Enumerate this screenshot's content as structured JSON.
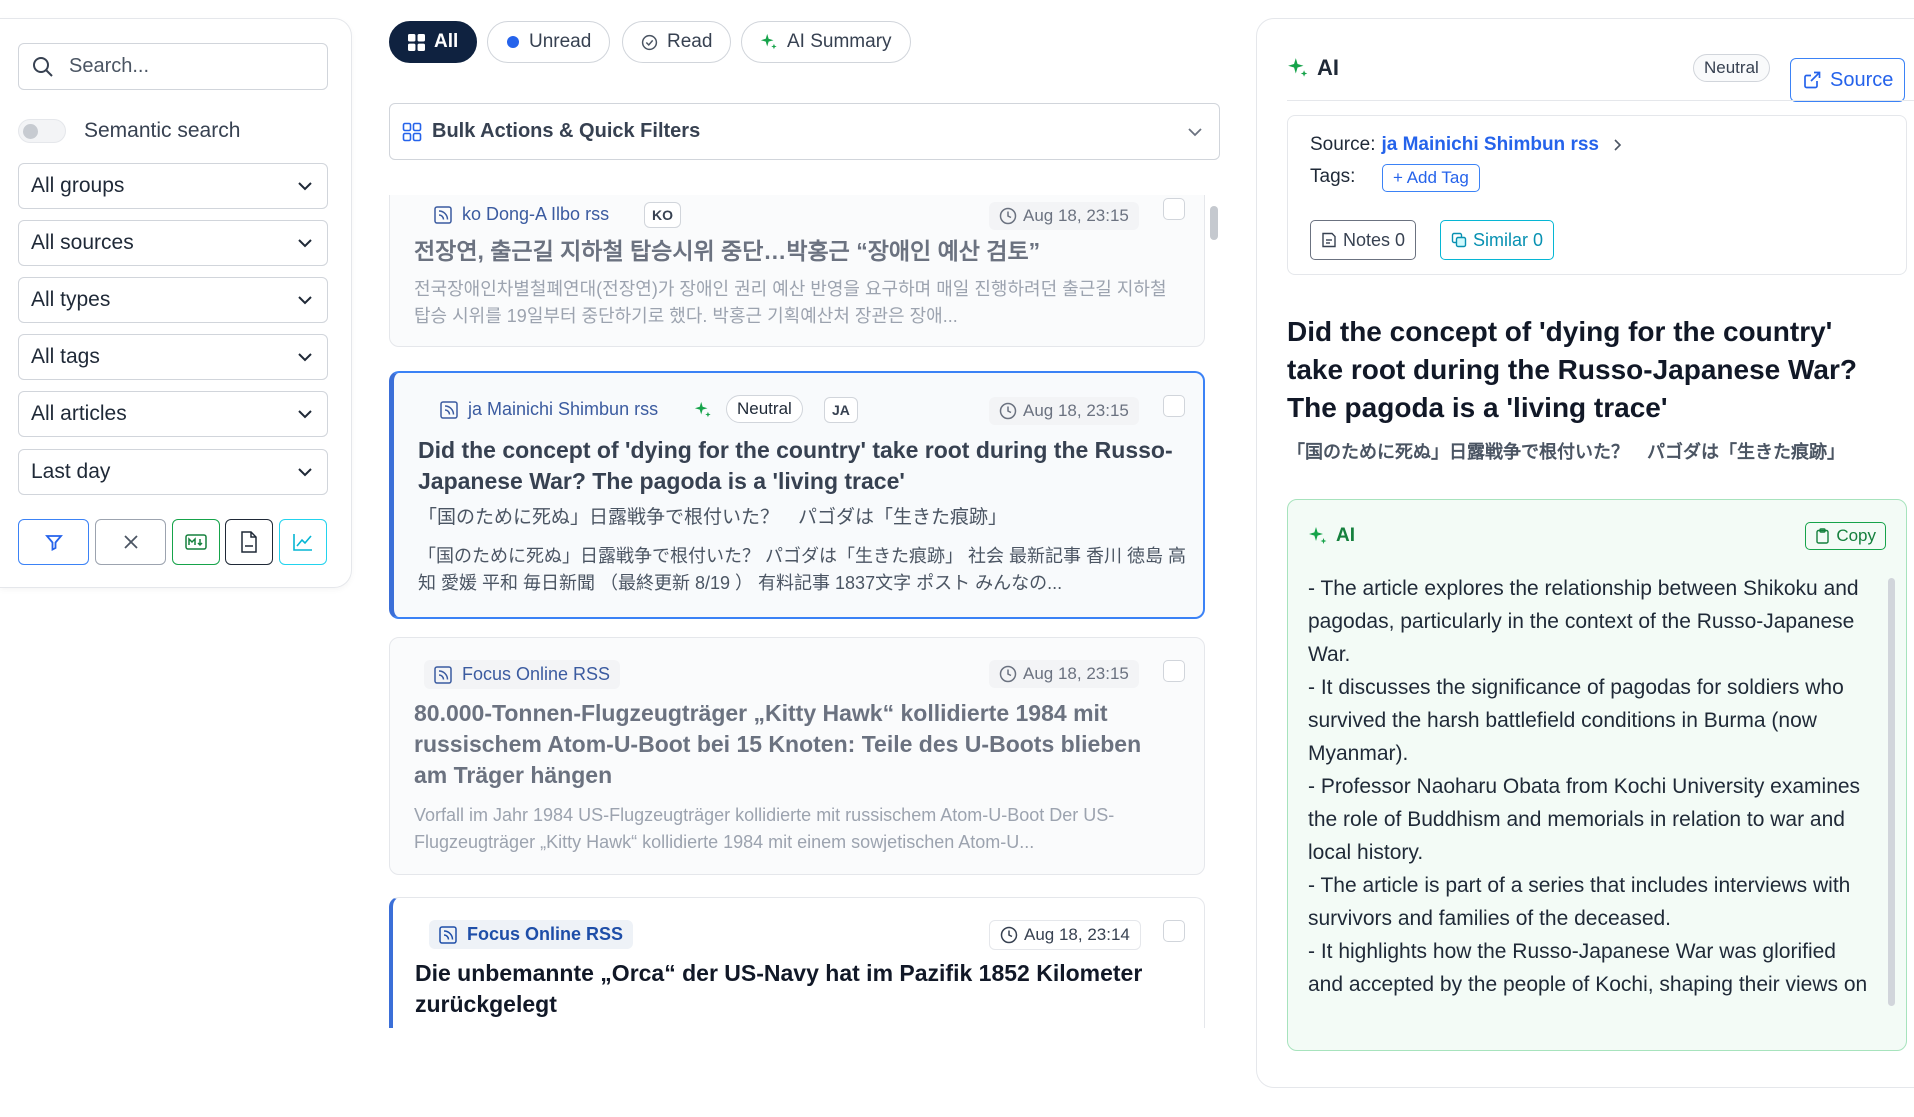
{
  "sidebar": {
    "search_placeholder": "Search...",
    "semantic_label": "Semantic search",
    "filters": [
      "All groups",
      "All sources",
      "All types",
      "All tags",
      "All articles",
      "Last day"
    ]
  },
  "tabs": [
    {
      "label": "All",
      "icon": "grid-icon"
    },
    {
      "label": "Unread",
      "icon": "dot-icon"
    },
    {
      "label": "Read",
      "icon": "check-circle-icon"
    },
    {
      "label": "AI Summary",
      "icon": "sparkle-icon"
    }
  ],
  "bulk": {
    "label": "Bulk Actions & Quick Filters"
  },
  "articles": [
    {
      "source": "ko Dong-A Ilbo rss",
      "lang": "KO",
      "time": "Aug 18, 23:15",
      "title": "전장연, 출근길 지하철 탑승시위 중단…박홍근 “장애인 예산 검토”",
      "desc": "전국장애인차별철폐연대(전장연)가 장애인 권리 예산 반영을 요구하며 매일 진행하려던 출근길 지하철 탑승 시위를 19일부터 중단하기로 했다. 박홍근 기획예산처 장관은 장애..."
    },
    {
      "source": "ja Mainichi Shimbun rss",
      "sentiment": "Neutral",
      "lang": "JA",
      "time": "Aug 18, 23:15",
      "title": "Did the concept of 'dying for the country' take root during the Russo-Japanese War? The pagoda is a 'living trace'",
      "subtitle": "「国のために死ぬ」日露戦争で根付いた？　パゴダは「生きた痕跡」",
      "desc": "「国のために死ぬ」日露戦争で根付いた？ パゴダは「生きた痕跡」 社会 最新記事 香川 徳島 高知 愛媛 平和 毎日新聞 （最終更新 8/19 ） 有料記事 1837文字 ポスト みんなの..."
    },
    {
      "source": "Focus Online RSS",
      "time": "Aug 18, 23:15",
      "title": "80.000-Tonnen-Flugzeugträger „Kitty Hawk“ kollidierte 1984 mit russischem Atom-U-Boot bei 15 Knoten: Teile des U-Boots blieben am Träger hängen",
      "desc": "Vorfall im Jahr 1984 US-Flugzeugträger kollidierte mit russischem Atom-U-Boot Der US-Flugzeugträger „Kitty Hawk“ kollidierte 1984 mit einem sowjetischen Atom-U..."
    },
    {
      "source": "Focus Online RSS",
      "time": "Aug 18, 23:14",
      "title": "Die unbemannte „Orca“ der US-Navy hat im Pazifik 1852 Kilometer zurückgelegt"
    }
  ],
  "panel": {
    "header": "AI",
    "sentiment": "Neutral",
    "source_btn": "Source",
    "source_label": "Source:",
    "source_name": "ja Mainichi Shimbun rss",
    "tags_label": "Tags:",
    "add_tag": "+ Add Tag",
    "notes": "Notes 0",
    "similar": "Similar 0",
    "title": "Did the concept of 'dying for the country' take root during the Russo-Japanese War? The pagoda is a 'living trace'",
    "subtitle": "「国のために死ぬ」日露戦争で根付いた？　パゴダは「生きた痕跡」",
    "ai_label": "AI",
    "copy": "Copy",
    "summary": [
      "- The article explores the relationship between Shikoku and pagodas, particularly in the context of the Russo-Japanese War.",
      "- It discusses the significance of pagodas for soldiers who survived the harsh battlefield conditions in Burma (now Myanmar).",
      "- Professor Naoharu Obata from Kochi University examines the role of Buddhism and memorials in relation to war and local history.",
      "- The article is part of a series that includes interviews with survivors and families of the deceased.",
      "- It highlights how the Russo-Japanese War was glorified and accepted by the people of Kochi, shaping their views on war and sacrifice."
    ]
  },
  "colors": {
    "accent": "#2563eb",
    "tab_active": "#0f2240",
    "ai_green": "#16a34a",
    "ai_box_bg": "#f3fbf6"
  }
}
